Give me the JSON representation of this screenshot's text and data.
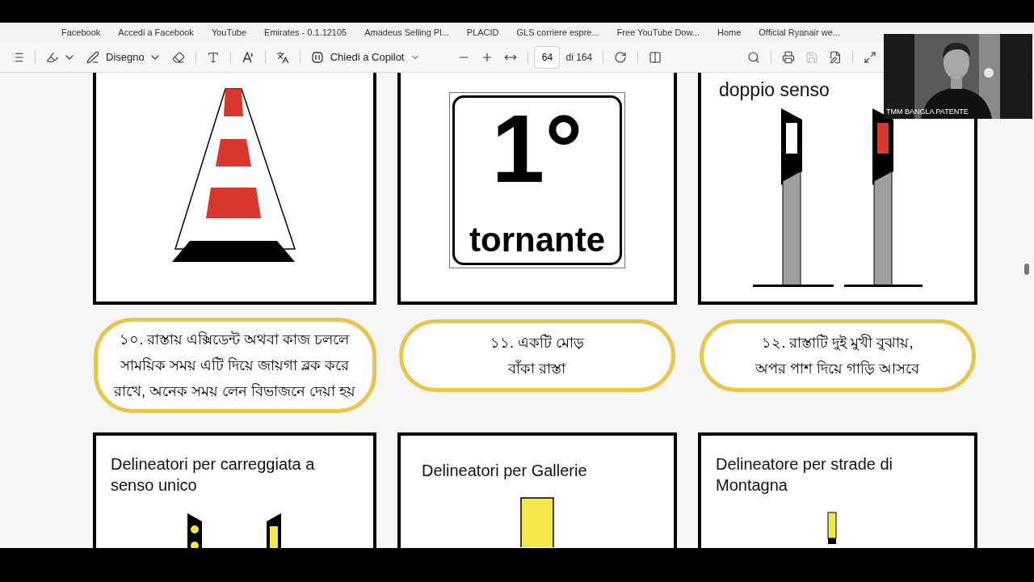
{
  "bookmarks": [
    {
      "label": "Facebook"
    },
    {
      "label": "Accedi a Facebook"
    },
    {
      "label": "YouTube"
    },
    {
      "label": "Emirates - 0.1.12105"
    },
    {
      "label": "Amadeus Selling Pl..."
    },
    {
      "label": "PLACID"
    },
    {
      "label": "GLS corriere espre..."
    },
    {
      "label": "Free YouTube Dow..."
    },
    {
      "label": "Home"
    },
    {
      "label": "Official Ryanair we..."
    }
  ],
  "toolbar": {
    "draw_label": "Disegno",
    "copilot_label": "Chiedi a Copilot",
    "page": "64",
    "page_total": "di 164",
    "save_disabled": true
  },
  "top_cards": [
    {
      "kind": "cone"
    },
    {
      "kind": "sign",
      "sign_number": "1°",
      "sign_text": "tornante"
    },
    {
      "kind": "double",
      "title": "doppio senso"
    }
  ],
  "captions": [
    {
      "lines": [
        "১০. রাস্তায় এক্সিডেন্ট অথবা কাজ চললে",
        "সাময়িক সময় এটি দিয়ে জায়গা ব্লক করে",
        "রাখে, অনেক সময় লেন বিভাজনে দেয়া হয়"
      ]
    },
    {
      "lines": [
        "১১. একটি মোড়",
        "বাঁকা রাস্তা"
      ]
    },
    {
      "lines": [
        "১২. রাস্তাটি দুই মুখী বুঝায়,",
        "অপর পাশ দিয়ে গাড়ি আসবে"
      ]
    }
  ],
  "bottom_cards": [
    {
      "kind": "single",
      "title": "Delineatori per carreggiata a senso unico"
    },
    {
      "kind": "tunnel",
      "title": "Delineatori per Gallerie"
    },
    {
      "kind": "mountain",
      "title": "Delineatore per strade di Montagna"
    }
  ],
  "webcam": {
    "label": "TMM BANGLA PATENTE"
  }
}
